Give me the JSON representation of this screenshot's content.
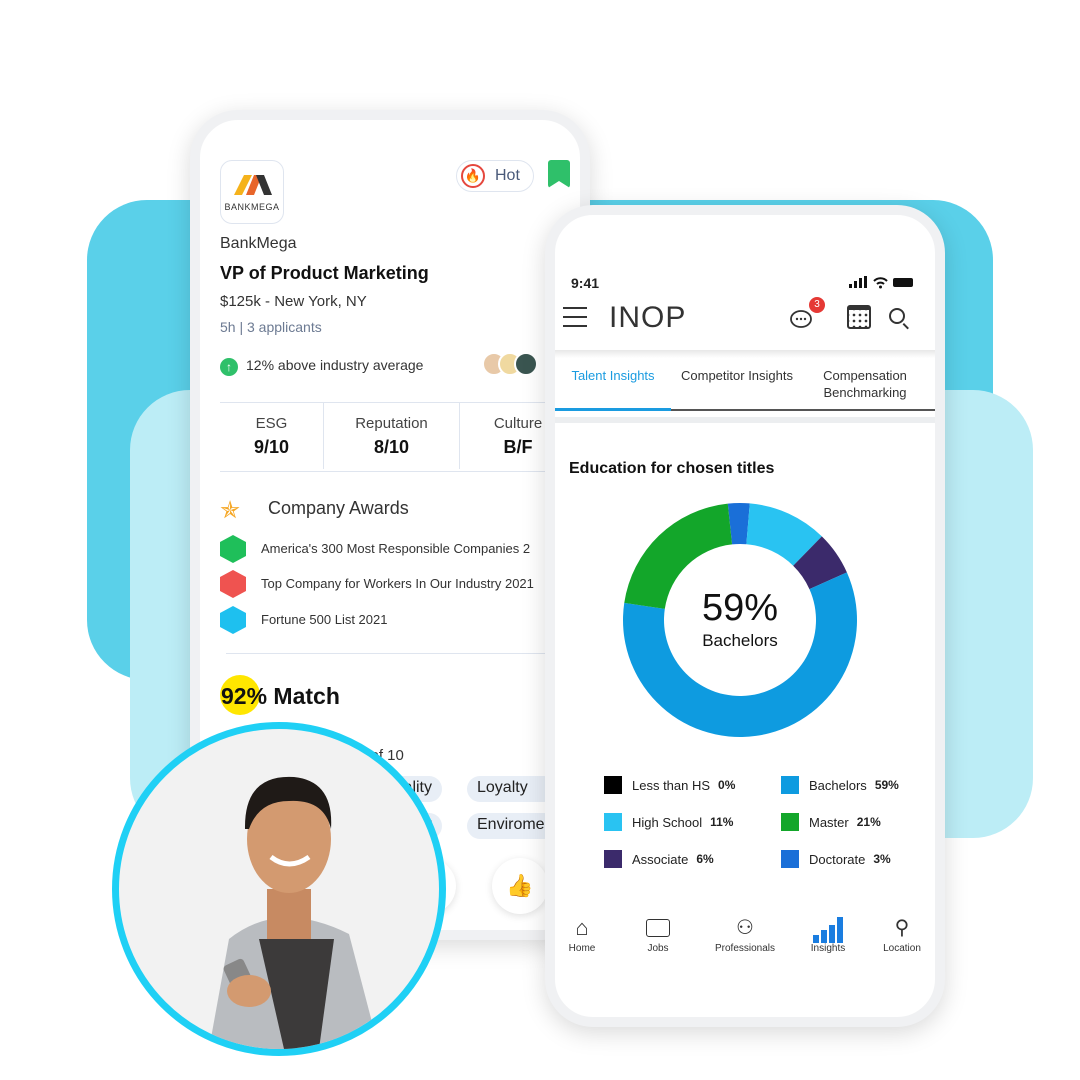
{
  "job_card": {
    "company_logo_text": "BANKMEGA",
    "hot_label": "Hot",
    "company": "BankMega",
    "title": "VP of Product Marketing",
    "salary_location": "$125k - New York, NY",
    "meta": "5h | 3 applicants",
    "industry_compare": "12% above industry average",
    "scores": [
      {
        "label": "ESG",
        "value": "9/10"
      },
      {
        "label": "Reputation",
        "value": "8/10"
      },
      {
        "label": "Culture",
        "value": "B/F"
      }
    ],
    "awards_title": "Company Awards",
    "awards": [
      "America's 300 Most Responsible Companies 2",
      "Top Company for Workers In Our Industry 2021",
      "Fortune 500 List 2021"
    ],
    "match": "92% Match",
    "match_sub": "0 of 10",
    "tags": [
      "ality",
      "Loyalty",
      "t",
      "Enviromer"
    ]
  },
  "insights_app": {
    "time": "9:41",
    "app_title": "INOP",
    "chat_badge": "3",
    "tabs": [
      {
        "label": "Talent Insights",
        "active": true
      },
      {
        "label": "Competitor Insights",
        "active": false
      },
      {
        "label": "Compensation Benchmarking",
        "active": false
      }
    ],
    "nav": [
      {
        "label": "Home",
        "icon": "home-icon"
      },
      {
        "label": "Jobs",
        "icon": "briefcase-icon"
      },
      {
        "label": "Professionals",
        "icon": "people-icon"
      },
      {
        "label": "Insights",
        "icon": "bar-chart-icon"
      },
      {
        "label": "Location",
        "icon": "location-pin-icon"
      }
    ]
  },
  "chart_data": {
    "type": "pie",
    "title": "Education for chosen titles",
    "center_value": "59%",
    "center_label": "Bachelors",
    "legend": "bottom",
    "slices": [
      {
        "name": "Less than HS",
        "value": 0,
        "label": "0%",
        "color": "#000000"
      },
      {
        "name": "High School",
        "value": 11,
        "label": "11%",
        "color": "#29c3f2"
      },
      {
        "name": "Associate",
        "value": 6,
        "label": "6%",
        "color": "#3b2a6b"
      },
      {
        "name": "Bachelors",
        "value": 59,
        "label": "59%",
        "color": "#0e9be0"
      },
      {
        "name": "Master",
        "value": 21,
        "label": "21%",
        "color": "#13a62a"
      },
      {
        "name": "Doctorate",
        "value": 3,
        "label": "3%",
        "color": "#1a6fd8"
      }
    ],
    "draw_order": [
      "Doctorate",
      "High School",
      "Associate",
      "Bachelors",
      "Master"
    ]
  }
}
